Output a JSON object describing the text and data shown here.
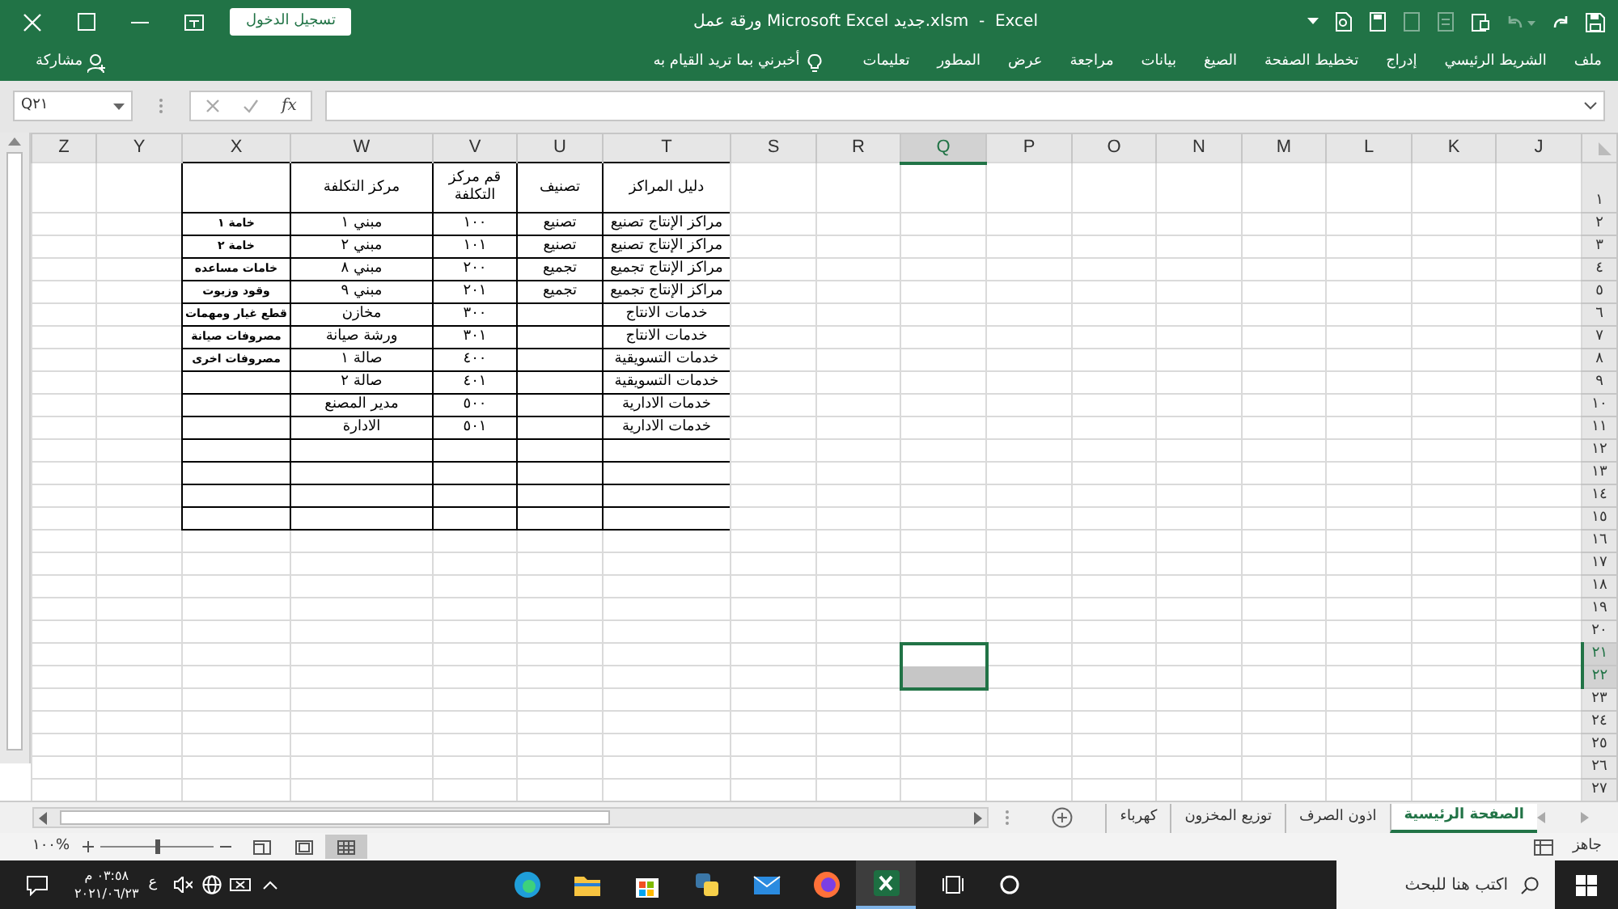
{
  "title_bar": {
    "title": "ورقة عمل Microsoft Excel جديد.xlsm  -  Excel",
    "sign_in": "تسجيل الدخول"
  },
  "ribbon": {
    "tabs": [
      {
        "label": "ملف"
      },
      {
        "label": "الشريط الرئيسي"
      },
      {
        "label": "إدراج"
      },
      {
        "label": "تخطيط الصفحة"
      },
      {
        "label": "الصيغ"
      },
      {
        "label": "بيانات"
      },
      {
        "label": "مراجعة"
      },
      {
        "label": "عرض"
      },
      {
        "label": "المطور"
      },
      {
        "label": "تعليمات"
      }
    ],
    "tell_me": "أخبرني بما تريد القيام به",
    "share": "مشاركة"
  },
  "formula_bar": {
    "name_box": "Q٢١",
    "fx": "fx"
  },
  "sheet": {
    "columns": [
      {
        "label": "J",
        "selected": false
      },
      {
        "label": "K",
        "selected": false
      },
      {
        "label": "L",
        "selected": false
      },
      {
        "label": "M",
        "selected": false
      },
      {
        "label": "N",
        "selected": false
      },
      {
        "label": "O",
        "selected": false
      },
      {
        "label": "P",
        "selected": false
      },
      {
        "label": "Q",
        "selected": true
      },
      {
        "label": "R",
        "selected": false
      },
      {
        "label": "S",
        "selected": false
      },
      {
        "label": "T",
        "selected": false
      },
      {
        "label": "U",
        "selected": false
      },
      {
        "label": "V",
        "selected": false
      },
      {
        "label": "W",
        "selected": false
      },
      {
        "label": "X",
        "selected": false
      },
      {
        "label": "Y",
        "selected": false
      },
      {
        "label": "Z",
        "selected": false
      }
    ],
    "rows": [
      {
        "label": "١",
        "selected": false,
        "center_guide": "دليل المراكز",
        "category": "تصنيف",
        "center_no": "قم مركز التكلفة",
        "cost_center": "مركز التكلفة"
      },
      {
        "label": "٢",
        "selected": false,
        "center_guide": "مراكز الإنتاج تصنيع",
        "category": "تصنيع",
        "center_no": "١٠٠",
        "cost_center": "مبني ١",
        "column_x": "خامة ١"
      },
      {
        "label": "٣",
        "selected": false,
        "center_guide": "مراكز الإنتاج تصنيع",
        "category": "تصنيع",
        "center_no": "١٠١",
        "cost_center": "مبني ٢",
        "column_x": "خامة ٢"
      },
      {
        "label": "٤",
        "selected": false,
        "center_guide": "مراكز الإنتاج تجميع",
        "category": "تجميع",
        "center_no": "٢٠٠",
        "cost_center": "مبني ٨",
        "column_x": "خامات مساعده"
      },
      {
        "label": "٥",
        "selected": false,
        "center_guide": "مراكز الإنتاج تجميع",
        "category": "تجميع",
        "center_no": "٢٠١",
        "cost_center": "مبني ٩",
        "column_x": "وقود وزيوت"
      },
      {
        "label": "٦",
        "selected": false,
        "center_guide": "خدمات الانتاج",
        "center_no": "٣٠٠",
        "cost_center": "مخازن",
        "column_x": "قطع غيار ومهمات"
      },
      {
        "label": "٧",
        "selected": false,
        "center_guide": "خدمات الانتاج",
        "center_no": "٣٠١",
        "cost_center": "ورشة صيانة",
        "column_x": "مصروفات صيانة"
      },
      {
        "label": "٨",
        "selected": false,
        "center_guide": "خدمات التسويقية",
        "center_no": "٤٠٠",
        "cost_center": "صالة ١",
        "column_x": "مصروفات اخرى"
      },
      {
        "label": "٩",
        "selected": false,
        "center_guide": "خدمات التسويقية",
        "center_no": "٤٠١",
        "cost_center": "صالة ٢"
      },
      {
        "label": "١٠",
        "selected": false,
        "center_guide": "خدمات الادارية",
        "center_no": "٥٠٠",
        "cost_center": "مدير المصنع"
      },
      {
        "label": "١١",
        "selected": false,
        "center_guide": "خدمات الادارية",
        "center_no": "٥٠١",
        "cost_center": "الادارة"
      },
      {
        "label": "١٢",
        "selected": false
      },
      {
        "label": "١٣",
        "selected": false
      },
      {
        "label": "١٤",
        "selected": false
      },
      {
        "label": "١٥",
        "selected": false
      },
      {
        "label": "١٦",
        "selected": false
      },
      {
        "label": "١٧",
        "selected": false
      },
      {
        "label": "١٨",
        "selected": false
      },
      {
        "label": "١٩",
        "selected": false
      },
      {
        "label": "٢٠",
        "selected": false
      },
      {
        "label": "٢١",
        "selected": true
      },
      {
        "label": "٢٢",
        "selected": true
      },
      {
        "label": "٢٣",
        "selected": false
      },
      {
        "label": "٢٤",
        "selected": false
      },
      {
        "label": "٢٥",
        "selected": false
      },
      {
        "label": "٢٦",
        "selected": false
      },
      {
        "label": "٢٧",
        "selected": false
      }
    ]
  },
  "sheet_tabs": [
    {
      "label": "الصفحة الرئيسية",
      "selected": true
    },
    {
      "label": "اذون الصرف",
      "selected": false
    },
    {
      "label": "توزيع المخزون",
      "selected": false
    },
    {
      "label": "كهرباء",
      "selected": false
    }
  ],
  "status_bar": {
    "status": "جاهز",
    "zoom": "١٠٠%",
    "zoom_slider": {
      "level": 0.5
    },
    "views": [
      {
        "kind": "normal",
        "selected": true
      },
      {
        "kind": "page_layout",
        "selected": false
      },
      {
        "kind": "page_break",
        "selected": false
      }
    ]
  },
  "taskbar": {
    "search_placeholder": "اكتب هنا للبحث",
    "apps": [
      {
        "kind": "excel",
        "selected": true
      },
      {
        "kind": "firefox",
        "selected": false
      },
      {
        "kind": "mail",
        "selected": false
      },
      {
        "kind": "python",
        "selected": false
      },
      {
        "kind": "store",
        "selected": false
      },
      {
        "kind": "explorer",
        "selected": false
      },
      {
        "kind": "edge",
        "selected": false
      }
    ],
    "language": "ع",
    "time": "٠٣:٥٨ م",
    "date": "٢٠٢١/٠٦/٢٣"
  }
}
